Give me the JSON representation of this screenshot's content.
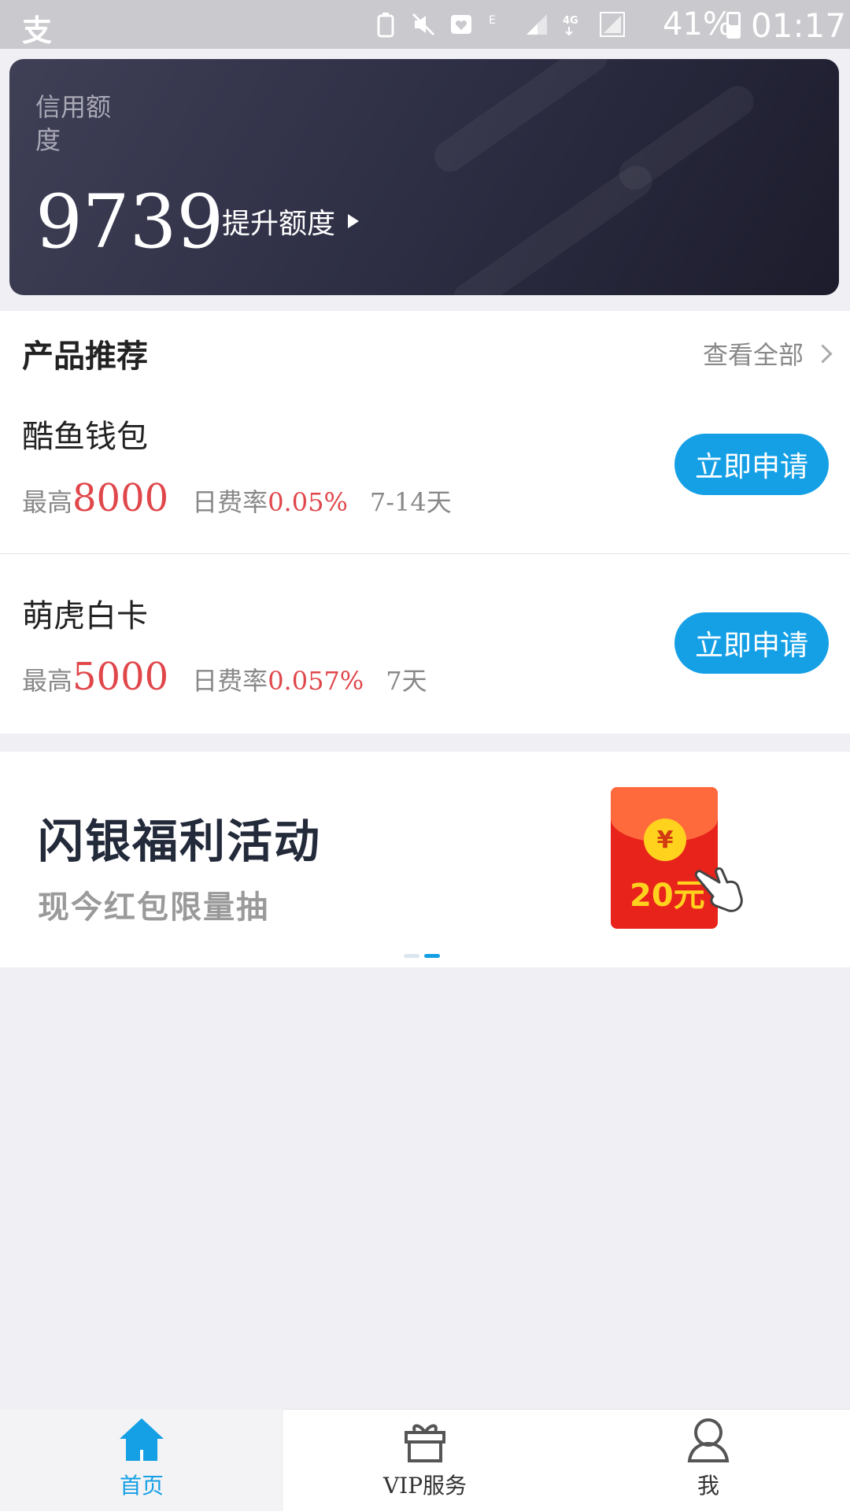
{
  "status_bar": {
    "battery": "41%",
    "time": "01:17"
  },
  "credit": {
    "label": "信用额度",
    "amount": "9739",
    "raise_label": "提升额度"
  },
  "products": {
    "title": "产品推荐",
    "view_all": "查看全部",
    "items": [
      {
        "name": "酷鱼钱包",
        "max_label": "最高",
        "max_value": "8000",
        "rate_label": "日费率",
        "rate_value": "0.05%",
        "term": "7-14天",
        "apply_label": "立即申请"
      },
      {
        "name": "萌虎白卡",
        "max_label": "最高",
        "max_value": "5000",
        "rate_label": "日费率",
        "rate_value": "0.057%",
        "term": "7天",
        "apply_label": "立即申请"
      }
    ]
  },
  "banner": {
    "title": "闪银福利活动",
    "subtitle": "现今红包限量抽",
    "envelope_symbol": "¥",
    "envelope_amount": "20元",
    "active_slide": 2,
    "slide_count": 2
  },
  "tabbar": {
    "tabs": [
      {
        "label": "首页",
        "icon": "home-icon",
        "active": true
      },
      {
        "label": "VIP服务",
        "icon": "gift-icon",
        "active": false
      },
      {
        "label": "我",
        "icon": "user-icon",
        "active": false
      }
    ]
  },
  "colors": {
    "accent": "#15a0e6",
    "highlight_red": "#e0474b",
    "card_dark": "#2f3046"
  }
}
